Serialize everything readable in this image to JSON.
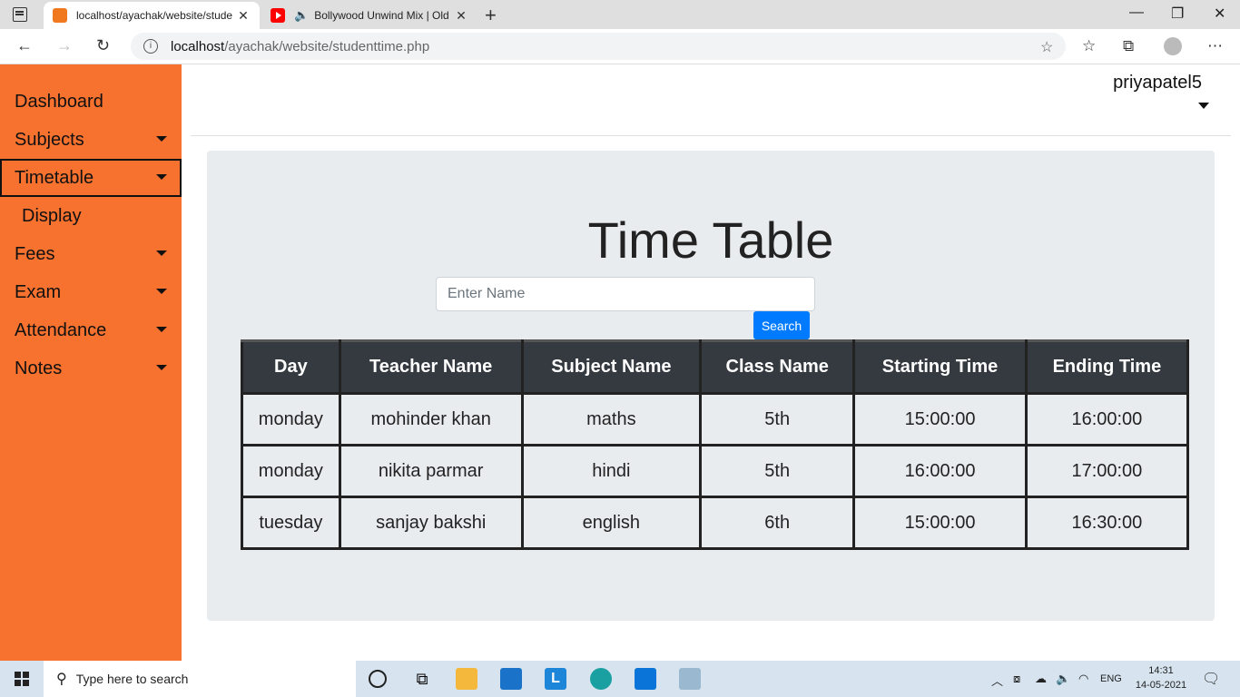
{
  "browser": {
    "tabs": [
      {
        "title": "localhost/ayachak/website/stude",
        "active": true
      },
      {
        "title": "Bollywood Unwind Mix | Old",
        "active": false
      }
    ],
    "url_host": "localhost",
    "url_path": "/ayachak/website/studenttime.php"
  },
  "sidebar": {
    "items": [
      {
        "label": "Dashboard",
        "has_caret": false
      },
      {
        "label": "Subjects",
        "has_caret": true
      },
      {
        "label": "Timetable",
        "has_caret": true,
        "selected": true
      },
      {
        "label": "Display",
        "sub": true
      },
      {
        "label": "Fees",
        "has_caret": true
      },
      {
        "label": "Exam",
        "has_caret": true
      },
      {
        "label": "Attendance",
        "has_caret": true
      },
      {
        "label": "Notes",
        "has_caret": true
      }
    ],
    "color": "#f7712f"
  },
  "header": {
    "username": "priyapatel5"
  },
  "main": {
    "title": "Time Table",
    "search_placeholder": "Enter Name",
    "search_value": "",
    "search_button": "Search"
  },
  "table": {
    "headers": [
      "Day",
      "Teacher Name",
      "Subject Name",
      "Class Name",
      "Starting Time",
      "Ending Time"
    ],
    "rows": [
      [
        "monday",
        "mohinder khan",
        "maths",
        "5th",
        "15:00:00",
        "16:00:00"
      ],
      [
        "monday",
        "nikita parmar",
        "hindi",
        "5th",
        "16:00:00",
        "17:00:00"
      ],
      [
        "tuesday",
        "sanjay bakshi",
        "english",
        "6th",
        "15:00:00",
        "16:30:00"
      ]
    ]
  },
  "taskbar": {
    "search_placeholder": "Type here to search",
    "language": "ENG",
    "time": "14:31",
    "date": "14-05-2021"
  }
}
